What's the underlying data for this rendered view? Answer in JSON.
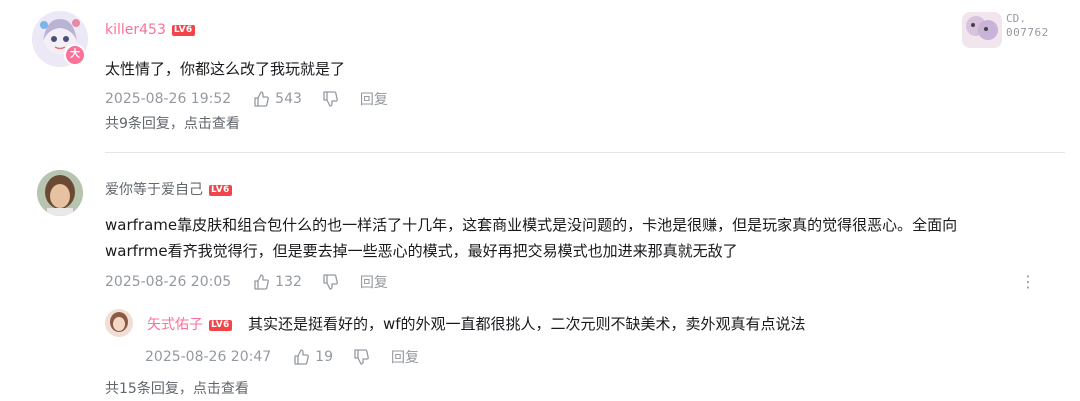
{
  "comments": [
    {
      "username": "killer453",
      "level": "LV6",
      "content": "太性情了，你都这么改了我玩就是了",
      "timestamp": "2025-08-26 19:52",
      "likes": "543",
      "reply_label": "回复",
      "replies_summary": "共9条回复，点击查看",
      "badge": {
        "code": "CD.",
        "number": "007762"
      }
    },
    {
      "username": "爱你等于爱自己",
      "level": "LV6",
      "content_line1": "warframe靠皮肤和组合包什么的也一样活了十几年，这套商业模式是没问题的，卡池是很赚，但是玩家真的觉得很恶心。全面向",
      "content_line2": "warfrme看齐我觉得行，但是要去掉一些恶心的模式，最好再把交易模式也加进来那真就无敌了",
      "timestamp": "2025-08-26 20:05",
      "likes": "132",
      "reply_label": "回复",
      "more": "⋮",
      "sub_reply": {
        "username": "矢式佑子",
        "level": "LV6",
        "content": "其实还是挺看好的，wf的外观一直都很挑人，二次元则不缺美术，卖外观真有点说法",
        "timestamp": "2025-08-26 20:47",
        "likes": "19",
        "reply_label": "回复"
      },
      "replies_summary": "共15条回复，点击查看"
    }
  ],
  "colors": {
    "level_badge": "#f2454a",
    "vip_name": "#fb7299",
    "meta": "#9499a0",
    "divider": "#e3e5e7"
  }
}
